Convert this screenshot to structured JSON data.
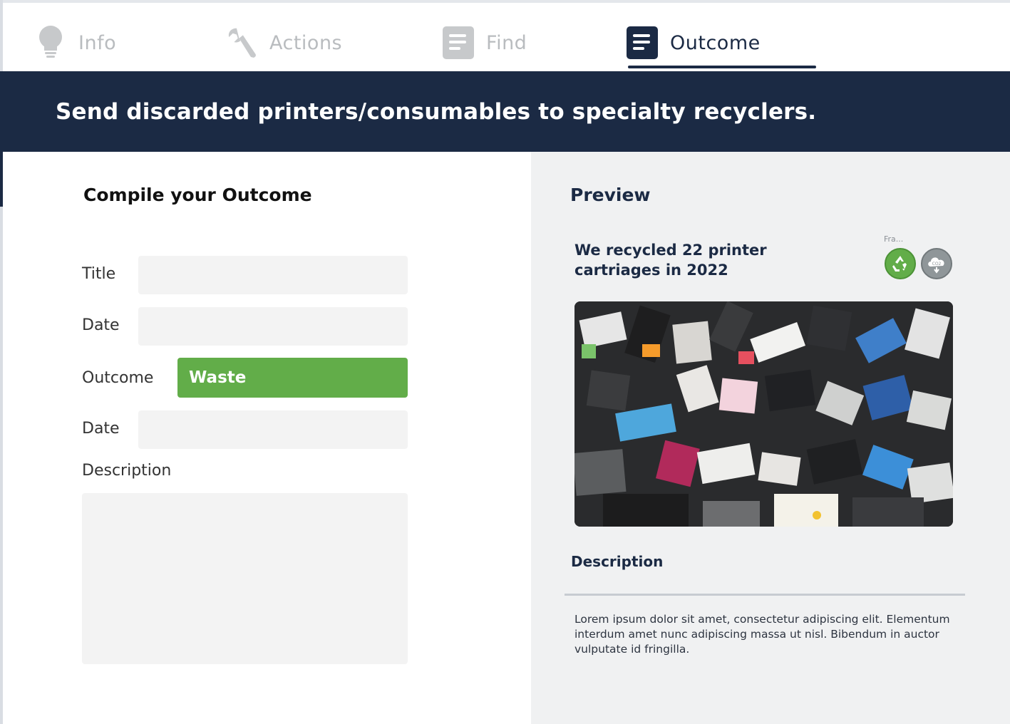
{
  "tabs": [
    {
      "label": "Info",
      "icon": "lightbulb-icon",
      "active": false
    },
    {
      "label": "Actions",
      "icon": "wrench-icon",
      "active": false
    },
    {
      "label": "Find",
      "icon": "document-icon",
      "active": false
    },
    {
      "label": "Outcome",
      "icon": "document-icon",
      "active": true
    }
  ],
  "banner": {
    "text": "Send discarded printers/consumables to specialty recyclers."
  },
  "form": {
    "heading": "Compile your Outcome",
    "title_label": "Title",
    "title_value": "",
    "date_label": "Date",
    "date_value": "",
    "outcome_label": "Outcome",
    "outcome_value": "Waste",
    "date2_label": "Date",
    "date2_value": "",
    "description_label": "Description",
    "description_value": ""
  },
  "preview": {
    "heading": "Preview",
    "card_title": "We recycled 22 printer cartriages in 2022",
    "badge_caption": "Fra...",
    "badges": [
      "recycle-icon",
      "co2-cloud-icon"
    ],
    "description_heading": "Description",
    "description_text": "Lorem ipsum dolor sit amet, consectetur adipiscing elit. Elementum interdum amet nunc adipiscing massa ut nisl. Bibendum in auctor vulputate id fringilla."
  },
  "colors": {
    "navy": "#1b2a44",
    "green": "#62ad49",
    "inactive_tab": "#b9bcbf",
    "preview_bg": "#f0f1f2",
    "input_bg": "#f3f3f3"
  }
}
